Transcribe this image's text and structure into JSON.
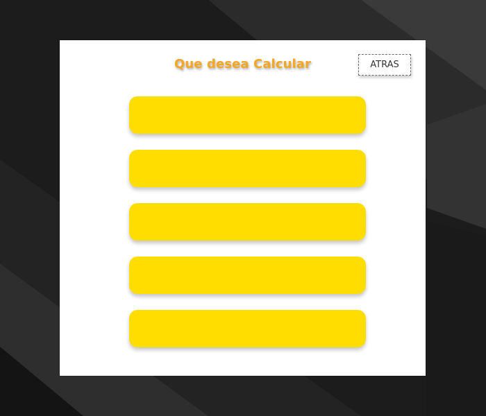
{
  "header": {
    "title": "Que desea Calcular",
    "back_label": "ATRAS"
  },
  "options": [
    {
      "label": ""
    },
    {
      "label": ""
    },
    {
      "label": ""
    },
    {
      "label": ""
    },
    {
      "label": ""
    }
  ],
  "colors": {
    "title": "#f5a623",
    "option_button": "#ffdd00",
    "panel": "#ffffff",
    "background": "#151515"
  }
}
